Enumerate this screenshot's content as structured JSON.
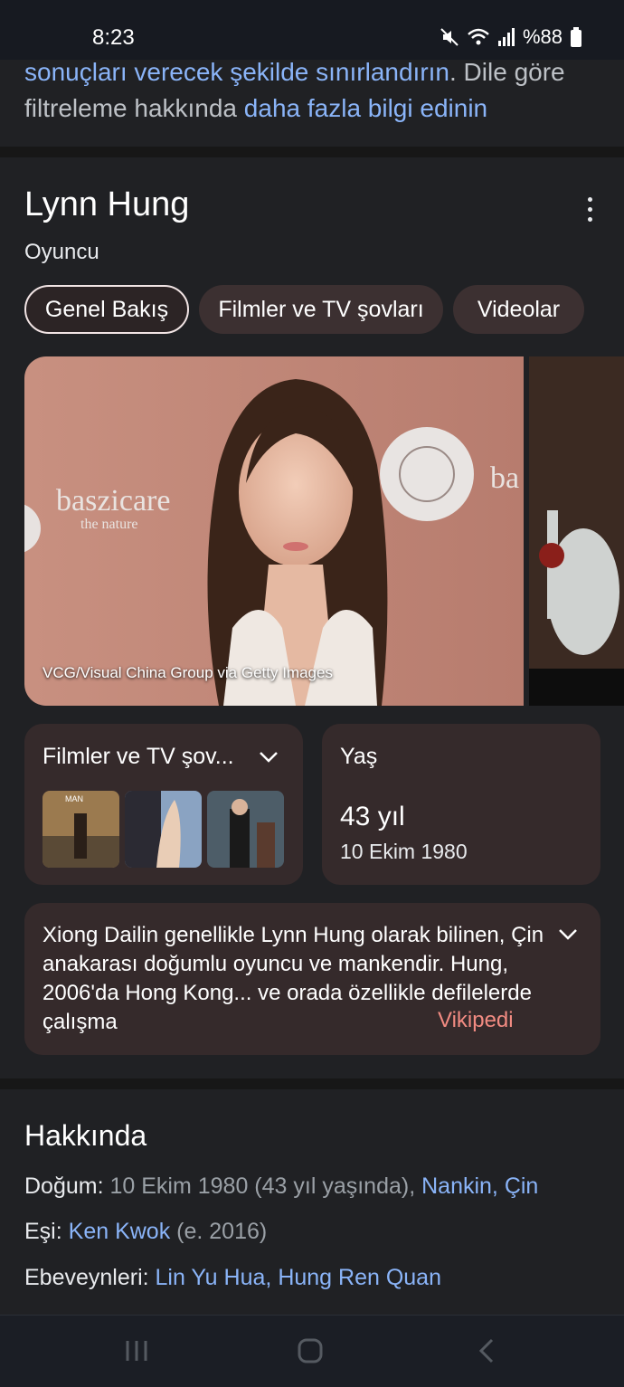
{
  "status": {
    "time": "8:23",
    "battery": "%88",
    "icons": [
      "mute-icon",
      "wifi-icon",
      "signal-icon",
      "battery-icon"
    ]
  },
  "snippet": {
    "link1": "sonuçları verecek şekilde sınırlandırın",
    "text1": ". Dile göre filtreleme hakkında ",
    "link2": "daha fazla bilgi edinin"
  },
  "knowledge_panel": {
    "title": "Lynn Hung",
    "subtitle": "Oyuncu",
    "tabs": [
      {
        "label": "Genel Bakış",
        "active": true
      },
      {
        "label": "Filmler ve TV şovları",
        "active": false
      },
      {
        "label": "Videolar",
        "active": false
      }
    ],
    "photo_credit": "VCG/Visual China Group via Getty Images",
    "films_card": {
      "title": "Filmler ve TV şov..."
    },
    "age_card": {
      "title": "Yaş",
      "value": "43 yıl",
      "date": "10 Ekim 1980"
    },
    "description": {
      "text": "Xiong Dailin genellikle Lynn Hung olarak bilinen, Çin anakarası doğumlu oyuncu ve mankendir. Hung, 2006'da Hong Kong... ve orada özellikle defilelerde çalışma",
      "source": "Vikipedi"
    }
  },
  "about": {
    "title": "Hakkında",
    "birth_label": "Doğum:",
    "birth_value": " 10 Ekim 1980 (43 yıl yaşında), ",
    "birth_place": "Nankin, Çin",
    "spouse_label": "Eşi:",
    "spouse_name": "Ken Kwok",
    "spouse_year": " (e. 2016)",
    "parents_label": "Ebeveynleri:",
    "parent1": "Lin Yu Hua",
    "parent_sep": ", ",
    "parent2": "Hung Ren Quan"
  },
  "colors": {
    "background": "#202124",
    "card": "#352a2b",
    "link": "#8ab4f8",
    "source": "#f28b82"
  }
}
